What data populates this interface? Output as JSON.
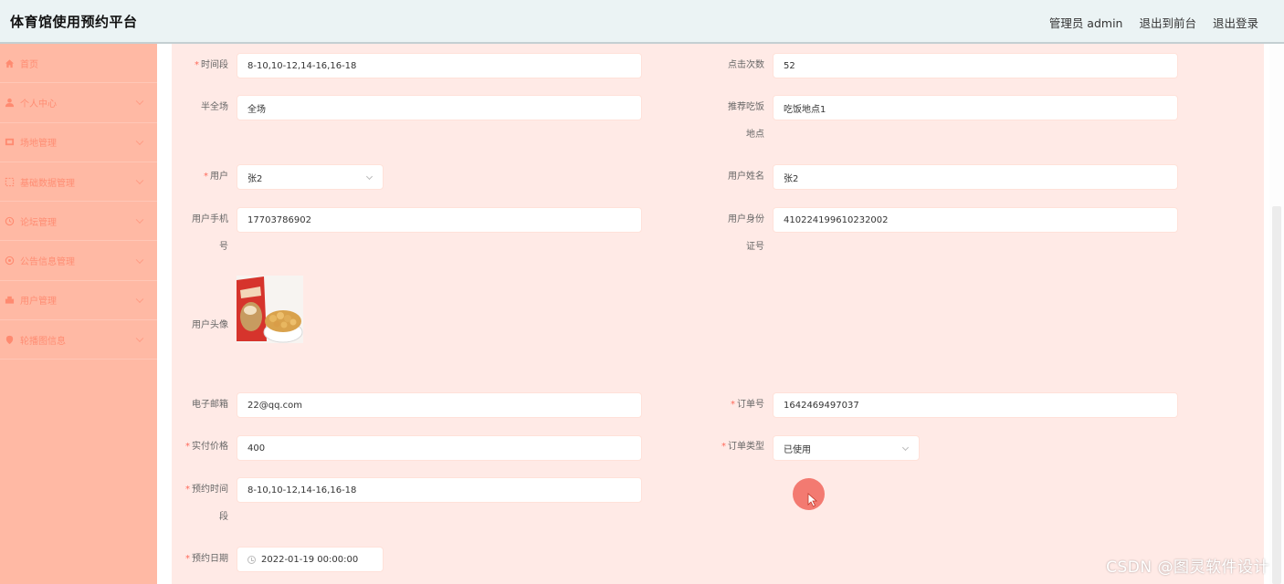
{
  "header": {
    "title": "体育馆使用预约平台",
    "admin": "管理员 admin",
    "back_front": "退出到前台",
    "logout": "退出登录"
  },
  "sidebar": {
    "items": [
      {
        "label": "首页",
        "icon": "home-icon"
      },
      {
        "label": "个人中心",
        "icon": "user-icon"
      },
      {
        "label": "场地管理",
        "icon": "venue-icon"
      },
      {
        "label": "基础数据管理",
        "icon": "data-icon"
      },
      {
        "label": "论坛管理",
        "icon": "forum-icon"
      },
      {
        "label": "公告信息管理",
        "icon": "notice-icon"
      },
      {
        "label": "用户管理",
        "icon": "users-icon"
      },
      {
        "label": "轮播图信息",
        "icon": "carousel-icon"
      }
    ]
  },
  "form": {
    "time_slot_label": "时间段",
    "time_slot_value": "8-10,10-12,14-16,16-18",
    "clicks_label": "点击次数",
    "clicks_value": "52",
    "half_full_label": "半全场",
    "half_full_value": "全场",
    "dining_label": "推荐吃饭地点",
    "dining_label_1": "推荐吃饭",
    "dining_label_2": "地点",
    "dining_value": "吃饭地点1",
    "user_label": "用户",
    "user_value": "张2",
    "user_name_label": "用户姓名",
    "user_name_value": "张2",
    "phone_label_1": "用户手机",
    "phone_label_2": "号",
    "phone_value": "17703786902",
    "idcard_label_1": "用户身份",
    "idcard_label_2": "证号",
    "idcard_value": "410224199610232002",
    "avatar_label": "用户头像",
    "email_label": "电子邮箱",
    "email_value": "22@qq.com",
    "order_no_label": "订单号",
    "order_no_value": "1642469497037",
    "price_label": "实付价格",
    "price_value": "400",
    "order_type_label": "订单类型",
    "order_type_value": "已使用",
    "booking_slot_label_1": "预约时间",
    "booking_slot_label_2": "段",
    "booking_slot_value": "8-10,10-12,14-16,16-18",
    "booking_date_label": "预约日期",
    "booking_date_value": "2022-01-19 00:00:00"
  },
  "watermark": "CSDN @图灵软件设计"
}
